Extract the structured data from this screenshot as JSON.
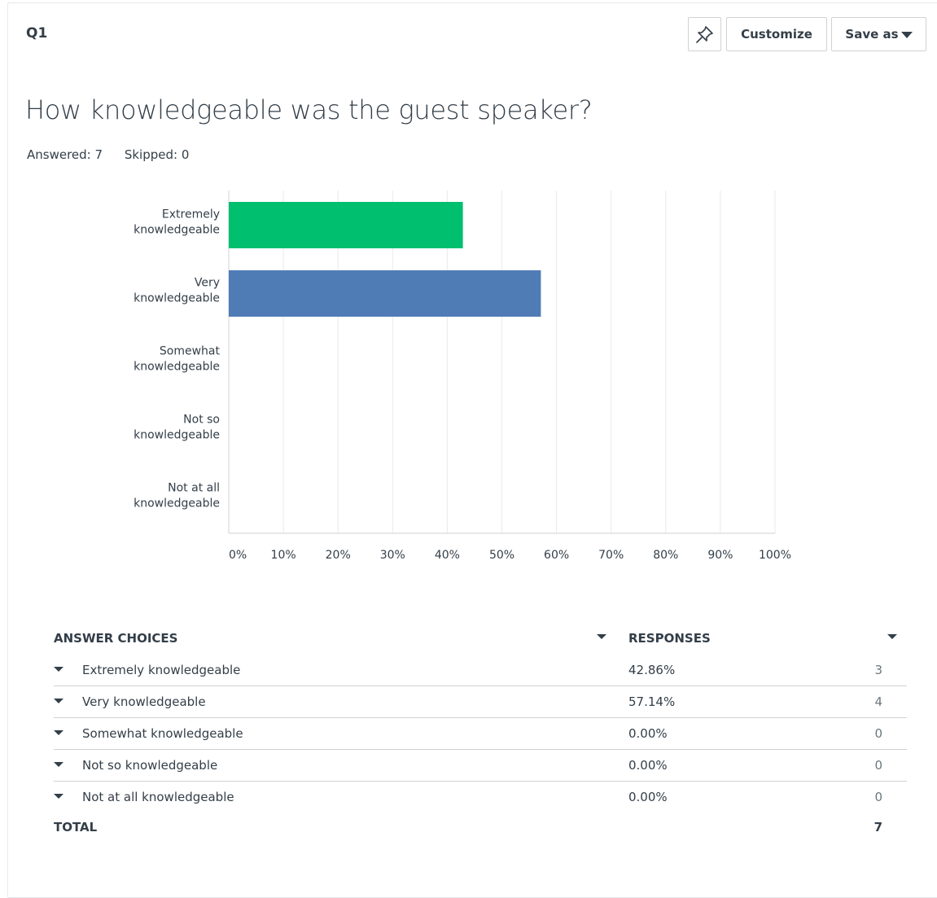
{
  "question": {
    "number": "Q1",
    "title": "How knowledgeable was the guest speaker?",
    "answered": "Answered: 7",
    "skipped": "Skipped: 0"
  },
  "toolbar": {
    "pin_icon": "pin-icon",
    "customize_label": "Customize",
    "saveas_label": "Save as"
  },
  "colors": {
    "bar_green": "#00bf6f",
    "bar_blue": "#507cb6",
    "grid": "#e9eaeb",
    "axis": "#d0d2d3"
  },
  "chart_data": {
    "type": "bar",
    "orientation": "horizontal",
    "categories": [
      [
        "Extremely",
        "knowledgeable"
      ],
      [
        "Very",
        "knowledgeable"
      ],
      [
        "Somewhat",
        "knowledgeable"
      ],
      [
        "Not so",
        "knowledgeable"
      ],
      [
        "Not at all",
        "knowledgeable"
      ]
    ],
    "values": [
      42.86,
      57.14,
      0,
      0,
      0
    ],
    "bar_colors": [
      "#00bf6f",
      "#507cb6",
      "#00bf6f",
      "#00bf6f",
      "#00bf6f"
    ],
    "xlim": [
      0,
      100
    ],
    "xticks": [
      "0%",
      "10%",
      "20%",
      "30%",
      "40%",
      "50%",
      "60%",
      "70%",
      "80%",
      "90%",
      "100%"
    ],
    "grid": true
  },
  "table": {
    "headers": [
      "ANSWER CHOICES",
      "RESPONSES"
    ],
    "rows": [
      {
        "label": "Extremely knowledgeable",
        "pct": "42.86%",
        "count": "3"
      },
      {
        "label": "Very knowledgeable",
        "pct": "57.14%",
        "count": "4"
      },
      {
        "label": "Somewhat knowledgeable",
        "pct": "0.00%",
        "count": "0"
      },
      {
        "label": "Not so knowledgeable",
        "pct": "0.00%",
        "count": "0"
      },
      {
        "label": "Not at all knowledgeable",
        "pct": "0.00%",
        "count": "0"
      }
    ],
    "total_label": "TOTAL",
    "total_value": "7"
  }
}
